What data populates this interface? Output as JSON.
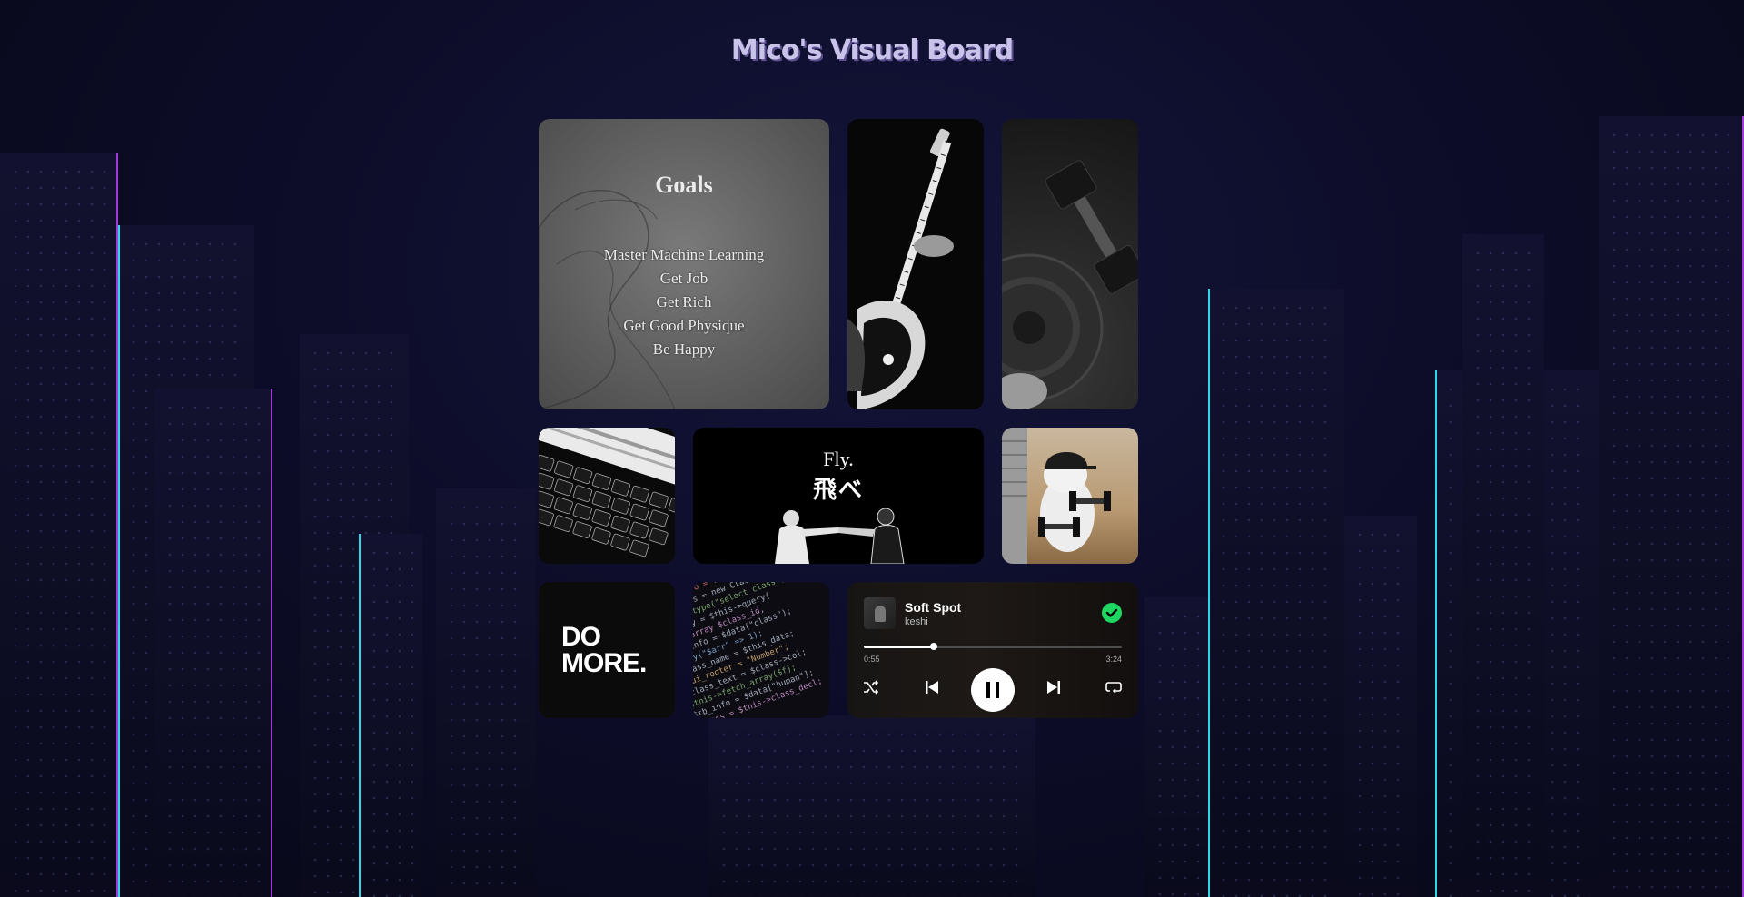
{
  "page": {
    "title": "Mico's Visual Board"
  },
  "goals": {
    "title": "Goals",
    "items": [
      "Master Machine Learning",
      "Get Job",
      "Get Rich",
      "Get Good Physique",
      "Be Happy"
    ]
  },
  "fly": {
    "english": "Fly.",
    "japanese": "飛べ"
  },
  "domore": {
    "line1": "DO",
    "line2": "MORE."
  },
  "player": {
    "song": "Soft Spot",
    "artist": "keshi",
    "current_time": "0:55",
    "total_time": "3:24",
    "progress": 0.27,
    "accent": "#1ed760",
    "icons": [
      "shuffle-icon",
      "previous-icon",
      "pause-icon",
      "next-icon",
      "repeat-icon",
      "check-icon"
    ]
  },
  "images": [
    "guitar-photo",
    "dumbbell-photo",
    "keyboard-photo",
    "cat-dumbbell-photo",
    "code-photo"
  ]
}
